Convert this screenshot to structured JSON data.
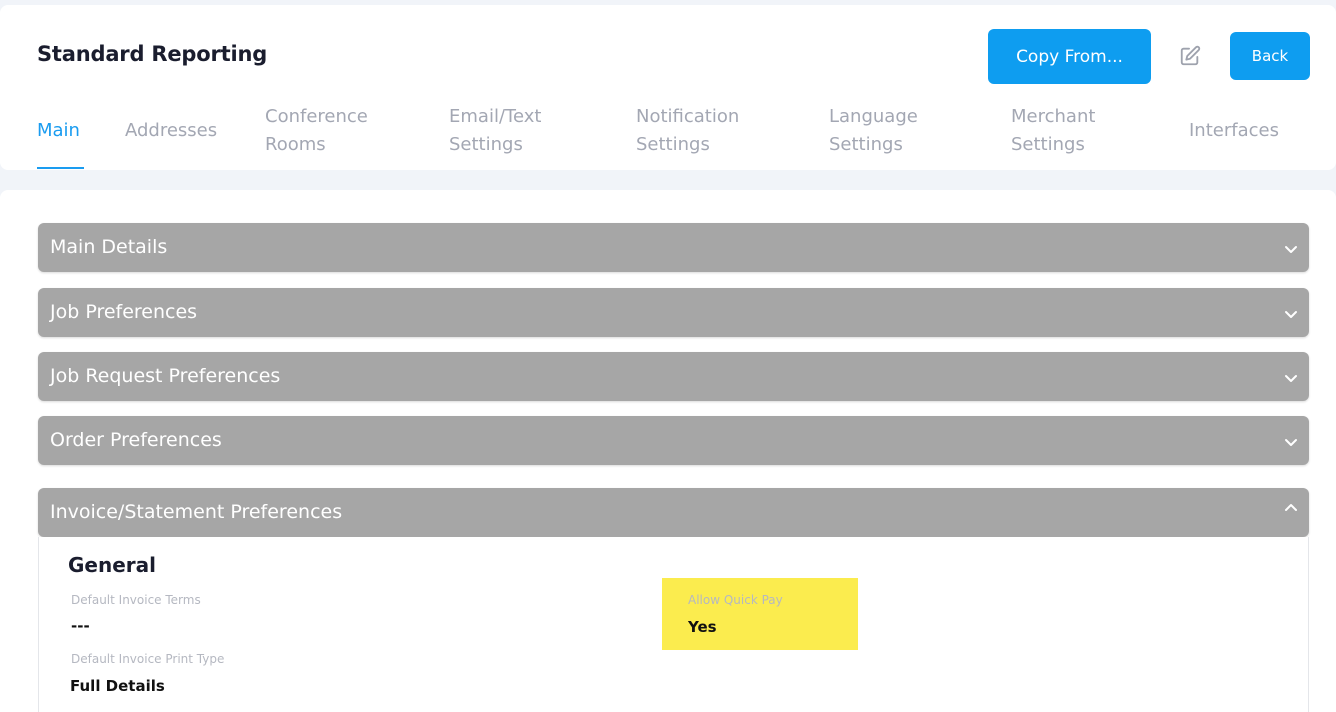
{
  "header": {
    "title": "Standard Reporting",
    "copy_from_label": "Copy From...",
    "back_label": "Back"
  },
  "tabs": [
    {
      "label": "Main",
      "active": true
    },
    {
      "label": "Addresses"
    },
    {
      "label": "Conference\nRooms"
    },
    {
      "label": "Email/Text\nSettings"
    },
    {
      "label": "Notification\nSettings"
    },
    {
      "label": "Language\nSettings"
    },
    {
      "label": "Merchant\nSettings"
    },
    {
      "label": "Interfaces"
    }
  ],
  "accordions": [
    {
      "title": "Main Details",
      "expanded": false
    },
    {
      "title": "Job Preferences",
      "expanded": false
    },
    {
      "title": "Job Request Preferences",
      "expanded": false
    },
    {
      "title": "Order Preferences",
      "expanded": false
    },
    {
      "title": "Invoice/Statement Preferences",
      "expanded": true
    }
  ],
  "invoice_section": {
    "heading": "General",
    "default_invoice_terms": {
      "label": "Default Invoice Terms",
      "value": "---"
    },
    "allow_quick_pay": {
      "label": "Allow Quick Pay",
      "value": "Yes",
      "highlight_color": "#fbec4e"
    },
    "default_invoice_print_type": {
      "label": "Default Invoice Print Type",
      "value": "Full Details"
    }
  },
  "colors": {
    "accent": "#0e9df0",
    "accordion_bg": "#a6a6a6",
    "tab_inactive": "#a3a7b3"
  }
}
